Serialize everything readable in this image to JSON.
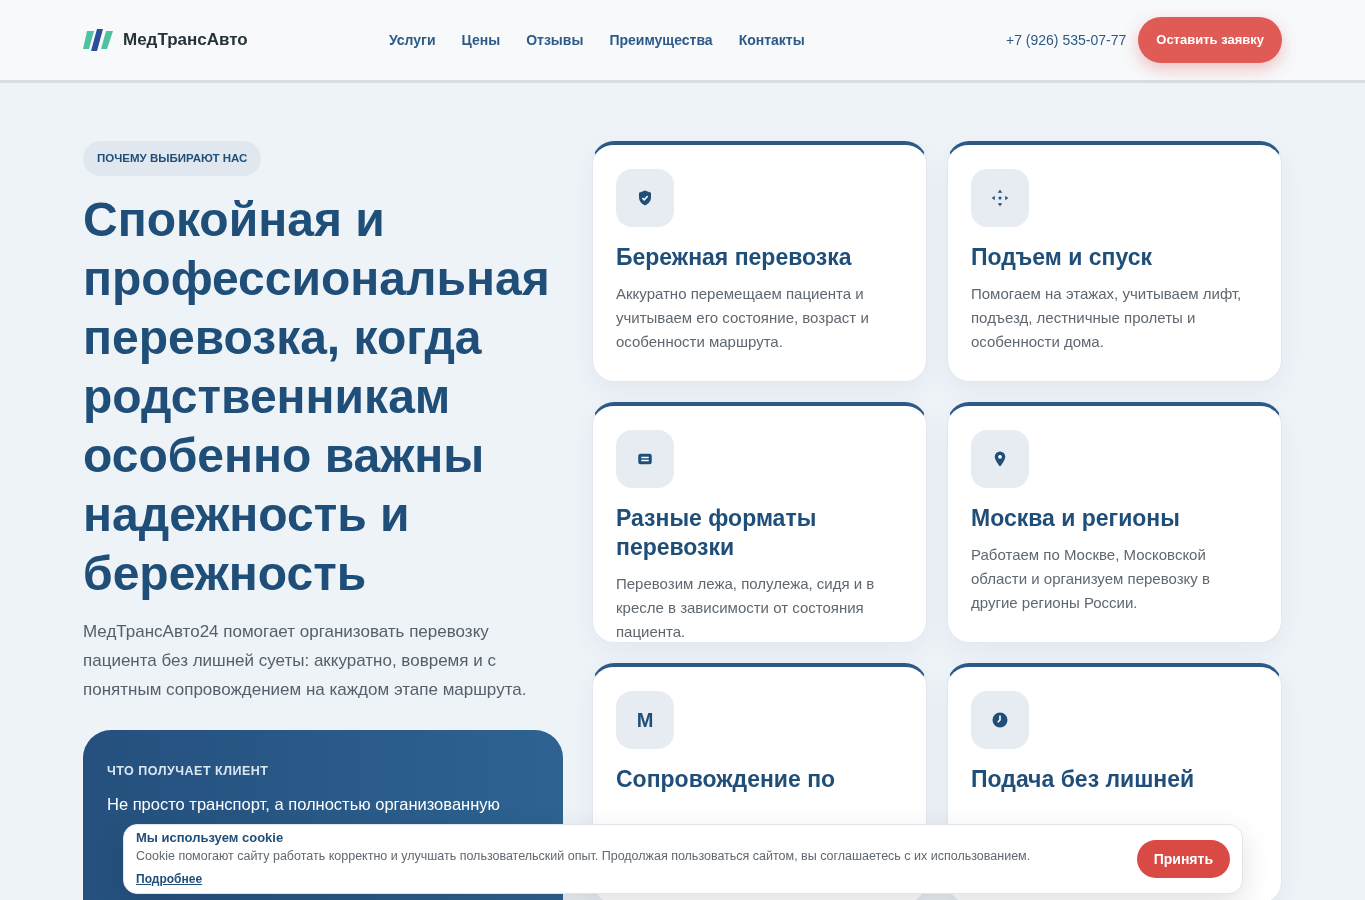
{
  "header": {
    "logo": "МедТрансАвто",
    "nav": [
      "Услуги",
      "Цены",
      "Отзывы",
      "Преимущества",
      "Контакты"
    ],
    "phone": "+7 (926) 535-07-77",
    "cta": "Оставить заявку"
  },
  "hero": {
    "badge": "ПОЧЕМУ ВЫБИРАЮТ НАС",
    "title": "Спокойная и профессиональная перевозка, когда родственникам особенно важны надежность и бережность",
    "lead": "МедТрансАвто24 помогает организовать перевозку пациента без лишней суеты: аккуратно, вовремя и с понятным сопровождением на каждом этапе маршрута."
  },
  "client_box": {
    "label": "ЧТО ПОЛУЧАЕТ КЛИЕНТ",
    "lines": [
      "Не просто транспорт, а полностью организованную"
    ]
  },
  "cards": [
    {
      "kind": "shield",
      "title": "Бережная перевозка",
      "text": "Аккуратно перемещаем пациента и учитываем его состояние, возраст и особенности маршрута."
    },
    {
      "kind": "move",
      "title": "Подъем и спуск",
      "text": "Помогаем на этажах, учитываем лифт, подъезд, лестничные пролеты и особенности дома."
    },
    {
      "kind": "card",
      "title": "Разные форматы перевозки",
      "text": "Перевозим лежа, полулежа, сидя и в кресле в зависимости от состояния пациента."
    },
    {
      "kind": "pin",
      "title": "Москва и регионы",
      "text": "Работаем по Москве, Московской области и организуем перевозку в другие регионы России."
    },
    {
      "kind": "letter",
      "letter": "М",
      "title": "Сопровождение по"
    },
    {
      "kind": "clock",
      "title": "Подача без лишней"
    }
  ],
  "cookie": {
    "title": "Мы используем cookie",
    "text": "Cookie помогают сайту работать корректно и улучшать пользовательский опыт. Продолжая пользоваться сайтом, вы соглашаетесь с их использованием.",
    "link": "Подробнее",
    "button": "Принять"
  }
}
